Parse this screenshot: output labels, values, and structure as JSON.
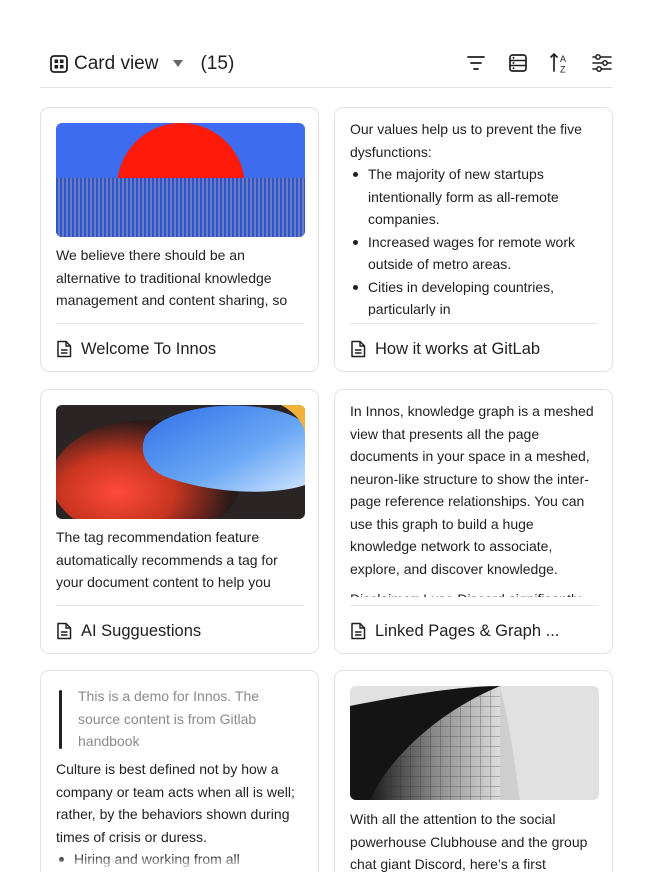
{
  "toolbar": {
    "view_icon": "grid-view-icon",
    "view_label": "Card view",
    "caret_icon": "caret-down-icon",
    "count": "(15)",
    "tools": [
      "filter-icon",
      "group-icon",
      "sort-az-icon",
      "settings-sliders-icon"
    ]
  },
  "cards": [
    {
      "title": "Welcome To Innos",
      "text": "We believe there should be an alternative to traditional knowledge management and content sharing, so",
      "image": "sunset-stripes-illustration"
    },
    {
      "title": "How it works at GitLab",
      "intro": "Our values help us to prevent the five dysfunctions:",
      "bullets": [
        "The majority of new startups intentionally form as all-remote companies.",
        "Increased wages for remote work outside of metro areas.",
        "Cities in developing countries, particularly in"
      ]
    },
    {
      "title": "AI Sugguestions",
      "text": "The tag recommendation feature automatically recommends a tag for your document content to help you",
      "image": "abstract-gradient-shapes"
    },
    {
      "title": "Linked Pages & Graph ...",
      "text": "In Innos, knowledge graph is a meshed view that presents all the page documents in your space in a meshed, neuron-like structure to show the inter-page reference relationships. You can use this graph to build a huge knowledge network to associate, explore, and discover knowledge.",
      "text2": "Disclaimer: I use Discord significantly"
    },
    {
      "quote": "This is a demo for Innos. The source content is from Gitlab handbook",
      "text": "Culture is best defined not by how a company or team acts when all is well; rather, by the behaviors shown during times of crisis or duress.",
      "bullets": [
        "Hiring and working from all"
      ]
    },
    {
      "text": "With all the attention to the social powerhouse Clubhouse and the group chat giant Discord, here’s a first",
      "image": "grayscale-architecture-photo"
    }
  ],
  "colors": {
    "text": "#1f1f1f",
    "muted": "#8a8a8a",
    "border": "#e2e2e2",
    "sun_red": "#ff1a0a",
    "sky_blue": "#3d6cf0"
  }
}
